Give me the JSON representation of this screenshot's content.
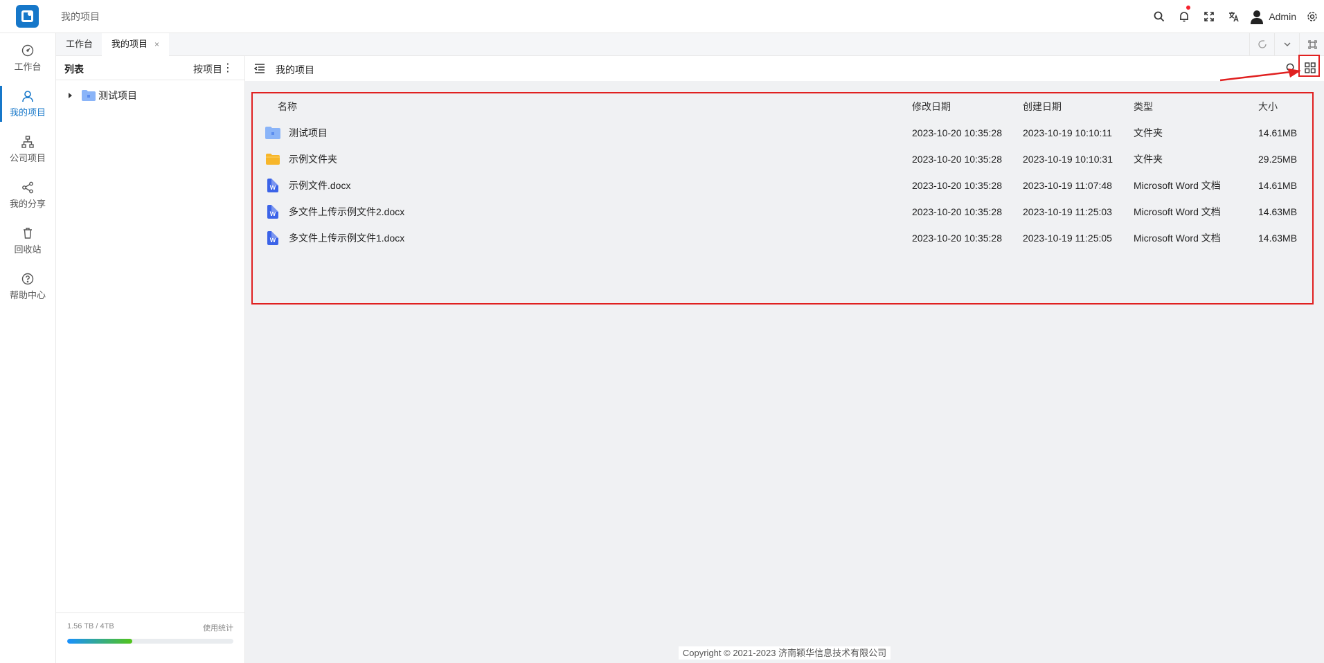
{
  "header": {
    "breadcrumb": "我的项目",
    "user_name": "Admin",
    "icons": [
      "search-icon",
      "bell-icon",
      "fullscreen-icon",
      "translate-icon",
      "avatar",
      "settings-icon"
    ]
  },
  "sidebar": {
    "items": [
      {
        "label": "工作台",
        "icon": "dashboard-icon"
      },
      {
        "label": "我的项目",
        "icon": "user-icon",
        "active": true
      },
      {
        "label": "公司项目",
        "icon": "org-icon"
      },
      {
        "label": "我的分享",
        "icon": "share-icon"
      },
      {
        "label": "回收站",
        "icon": "trash-icon"
      },
      {
        "label": "帮助中心",
        "icon": "help-icon"
      }
    ]
  },
  "tabs": [
    {
      "label": "工作台"
    },
    {
      "label": "我的项目",
      "close": "×",
      "active": true
    }
  ],
  "left_panel": {
    "title": "列表",
    "sort_label": "按项目",
    "more": "⋮",
    "tree": [
      {
        "label": "测试项目"
      }
    ],
    "usage_text": "1.56 TB / 4TB",
    "usage_link": "使用统计",
    "usage_percent": 39
  },
  "main": {
    "title": "我的项目",
    "columns": {
      "name": "名称",
      "modified": "修改日期",
      "created": "创建日期",
      "type": "类型",
      "size": "大小"
    },
    "rows": [
      {
        "name": "测试项目",
        "modified": "2023-10-20 10:35:28",
        "created": "2023-10-19 10:10:11",
        "type": "文件夹",
        "size": "14.61MB",
        "icon": "project-folder-icon"
      },
      {
        "name": "示例文件夹",
        "modified": "2023-10-20 10:35:28",
        "created": "2023-10-19 10:10:31",
        "type": "文件夹",
        "size": "29.25MB",
        "icon": "folder-icon"
      },
      {
        "name": "示例文件.docx",
        "modified": "2023-10-20 10:35:28",
        "created": "2023-10-19 11:07:48",
        "type": "Microsoft Word 文档",
        "size": "14.61MB",
        "icon": "word-icon"
      },
      {
        "name": "多文件上传示例文件2.docx",
        "modified": "2023-10-20 10:35:28",
        "created": "2023-10-19 11:25:03",
        "type": "Microsoft Word 文档",
        "size": "14.63MB",
        "icon": "word-icon"
      },
      {
        "name": "多文件上传示例文件1.docx",
        "modified": "2023-10-20 10:35:28",
        "created": "2023-10-19 11:25:05",
        "type": "Microsoft Word 文档",
        "size": "14.63MB",
        "icon": "word-icon"
      }
    ],
    "word_letter": "W"
  },
  "footer": "Copyright © 2021-2023 济南颖华信息技术有限公司",
  "colors": {
    "accent": "#1677c9",
    "highlight": "#e02020",
    "word": "#3b63e8",
    "folder": "#f7b62a"
  }
}
